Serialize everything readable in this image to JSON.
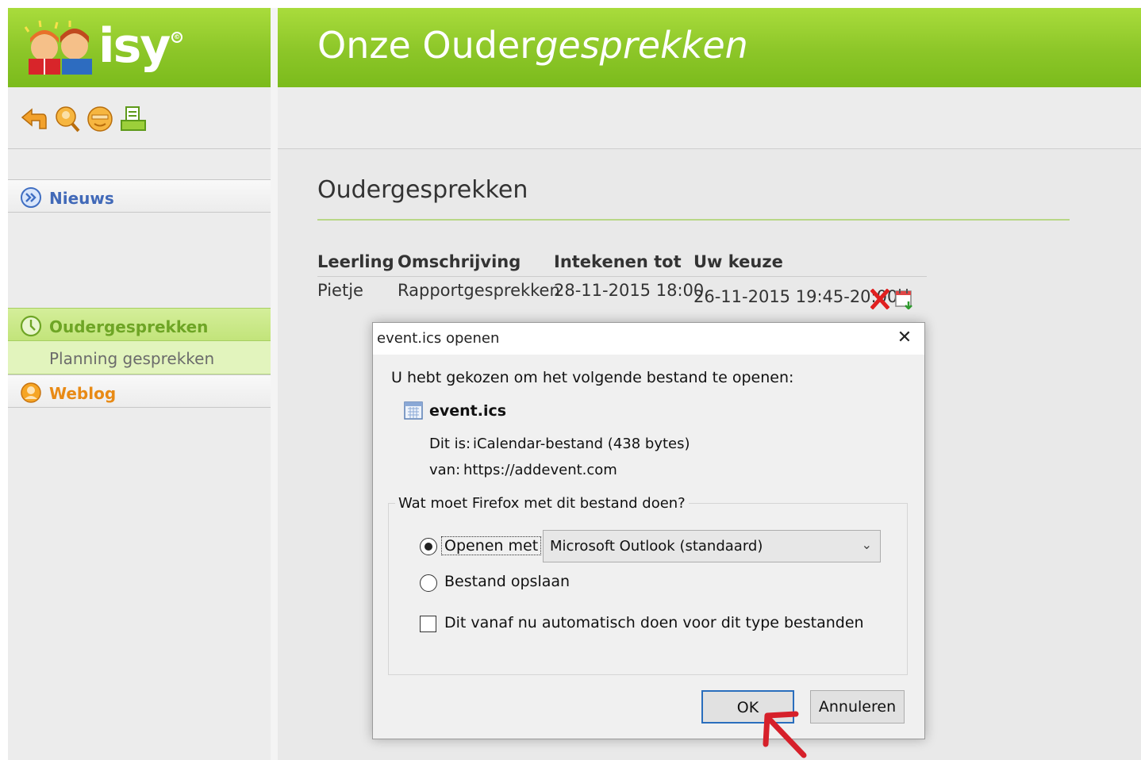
{
  "colors": {
    "brand_green": "#8cc628",
    "link_blue": "#4169b8",
    "active_green": "#6ea525",
    "weblog_orange": "#e88a15",
    "delete_red": "#e02020",
    "annotation_arrow": "#d6202a",
    "ok_focus_border": "#2a6ebd"
  },
  "sidebar": {
    "logo_text": "isy",
    "logo_mark": "©",
    "toolbar_icons": [
      "back-arrow-icon",
      "search-person-icon",
      "smiley-icon",
      "print-icon"
    ],
    "menu": [
      {
        "label": "Nieuws",
        "icon": "news-arrow-icon"
      },
      {
        "label": "Oudergesprekken",
        "icon": "clock-icon"
      },
      {
        "label": "Planning gesprekken"
      },
      {
        "label": "Weblog",
        "icon": "person-icon"
      }
    ]
  },
  "main": {
    "title_plain": "Onze Ouder",
    "title_italic": "gesprekken",
    "section_title": "Oudergesprekken",
    "table": {
      "headers": [
        "Leerling",
        "Omschrijving",
        "Intekenen tot",
        "Uw keuze"
      ],
      "row": [
        "Pietje",
        "Rapportgesprekken",
        "28-11-2015 18:00",
        "26-11-2015 19:45-20:00"
      ]
    }
  },
  "dialog": {
    "title": "event.ics openen",
    "close_glyph": "✕",
    "intro": "U hebt gekozen om het volgende bestand te openen:",
    "file_name": "event.ics",
    "type_label": "Dit is:",
    "type_value": "iCalendar-bestand (438 bytes)",
    "from_label": "van:",
    "from_value": "https://addevent.com",
    "question": "Wat moet Firefox met dit bestand doen?",
    "open_with_label": "Openen met",
    "open_with_app": "Microsoft Outlook (standaard)",
    "save_label": "Bestand opslaan",
    "auto_label": "Dit vanaf nu automatisch doen voor dit type bestanden",
    "ok_label": "OK",
    "cancel_label": "Annuleren",
    "open_with_selected": true,
    "auto_checked": false
  }
}
